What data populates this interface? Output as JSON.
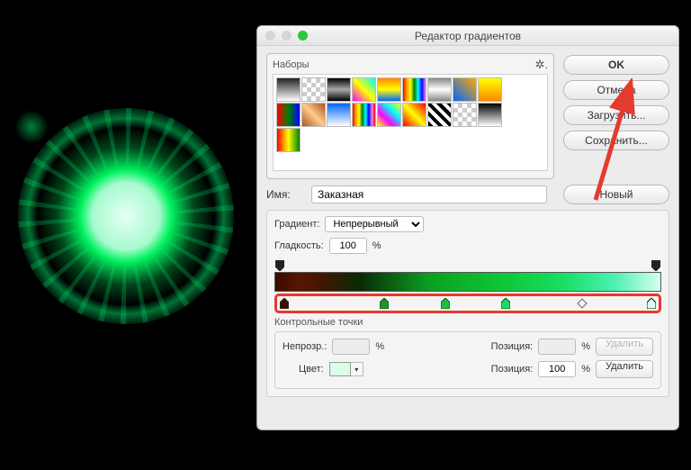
{
  "window": {
    "title": "Редактор градиентов"
  },
  "presets": {
    "label": "Наборы"
  },
  "buttons": {
    "ok": "OK",
    "cancel": "Отмена",
    "load": "Загрузить...",
    "save": "Сохранить...",
    "new": "Новый"
  },
  "name": {
    "label": "Имя:",
    "value": "Заказная"
  },
  "gradient": {
    "type_label": "Градиент:",
    "type_value": "Непрерывный",
    "smoothness_label": "Гладкость:",
    "smoothness_value": "100",
    "smoothness_unit": "%"
  },
  "stops": {
    "title": "Контрольные точки",
    "opacity_label": "Непрозр.:",
    "opacity_value": "",
    "opacity_unit": "%",
    "opacity_pos_label": "Позиция:",
    "opacity_pos_value": "",
    "opacity_pos_unit": "%",
    "opacity_delete": "Удалить",
    "color_label": "Цвет:",
    "color_value": "#d8ffe8",
    "color_pos_label": "Позиция:",
    "color_pos_value": "100",
    "color_pos_unit": "%",
    "color_delete": "Удалить"
  }
}
